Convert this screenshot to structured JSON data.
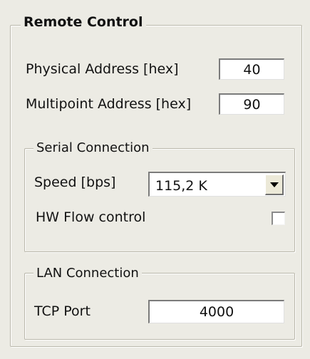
{
  "remote_control": {
    "title": "Remote Control",
    "physical_address": {
      "label": "Physical Address [hex]",
      "value": "40"
    },
    "multipoint_address": {
      "label": "Multipoint Address [hex]",
      "value": "90"
    }
  },
  "serial_connection": {
    "title": "Serial Connection",
    "speed": {
      "label": "Speed [bps]",
      "value": "115,2 K"
    },
    "hw_flow_control": {
      "label": "HW Flow control",
      "checked": false
    }
  },
  "lan_connection": {
    "title": "LAN Connection",
    "tcp_port": {
      "label": "TCP Port",
      "value": "4000"
    }
  }
}
